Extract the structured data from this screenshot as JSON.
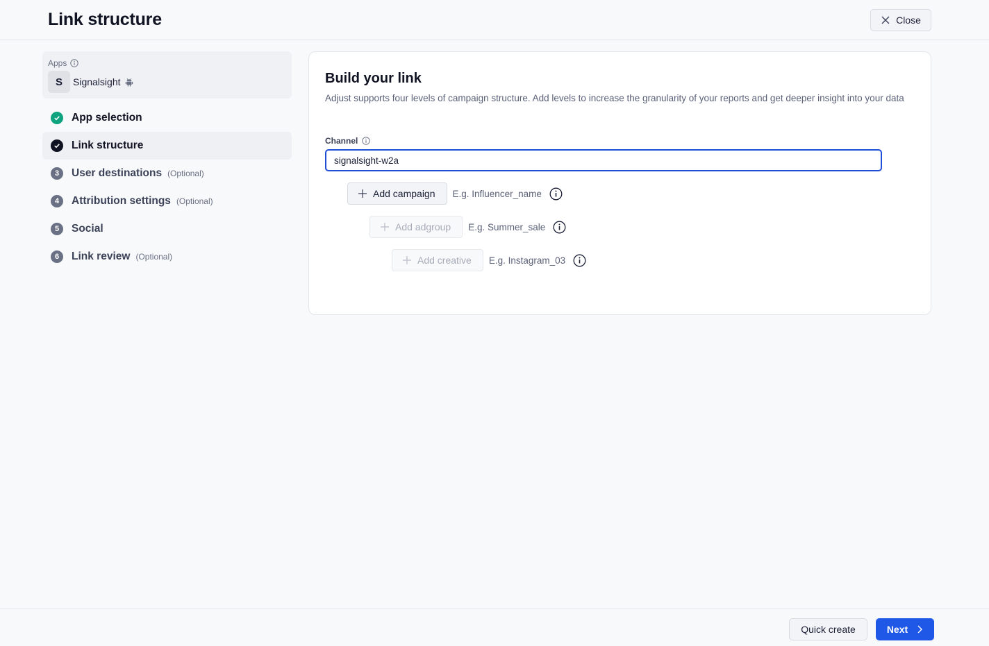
{
  "header": {
    "title": "Link structure",
    "close_label": "Close"
  },
  "sidebar": {
    "apps_label": "Apps",
    "app": {
      "initial": "S",
      "name": "Signalsight",
      "platform_icon": "android-icon"
    },
    "steps": [
      {
        "number": "",
        "label": "App selection",
        "optional": "",
        "state": "done"
      },
      {
        "number": "",
        "label": "Link structure",
        "optional": "",
        "state": "current"
      },
      {
        "number": "3",
        "label": "User destinations",
        "optional": "(Optional)",
        "state": "pending"
      },
      {
        "number": "4",
        "label": "Attribution settings",
        "optional": "(Optional)",
        "state": "pending"
      },
      {
        "number": "5",
        "label": "Social",
        "optional": "",
        "state": "pending"
      },
      {
        "number": "6",
        "label": "Link review",
        "optional": "(Optional)",
        "state": "pending"
      }
    ]
  },
  "main": {
    "title": "Build your link",
    "description": "Adjust supports four levels of campaign structure. Add levels to increase the granularity of your reports and get deeper insight into your data",
    "channel_label": "Channel",
    "channel_value": "signalsight-w2a",
    "levels": [
      {
        "label": "Add campaign",
        "example": "E.g. Influencer_name",
        "enabled": true
      },
      {
        "label": "Add adgroup",
        "example": "E.g. Summer_sale",
        "enabled": false
      },
      {
        "label": "Add creative",
        "example": "E.g. Instagram_03",
        "enabled": false
      }
    ]
  },
  "footer": {
    "quick_create_label": "Quick create",
    "next_label": "Next"
  },
  "colors": {
    "primary": "#1f57e6",
    "success": "#0fa37f",
    "focus_border": "#1f4fd6"
  }
}
